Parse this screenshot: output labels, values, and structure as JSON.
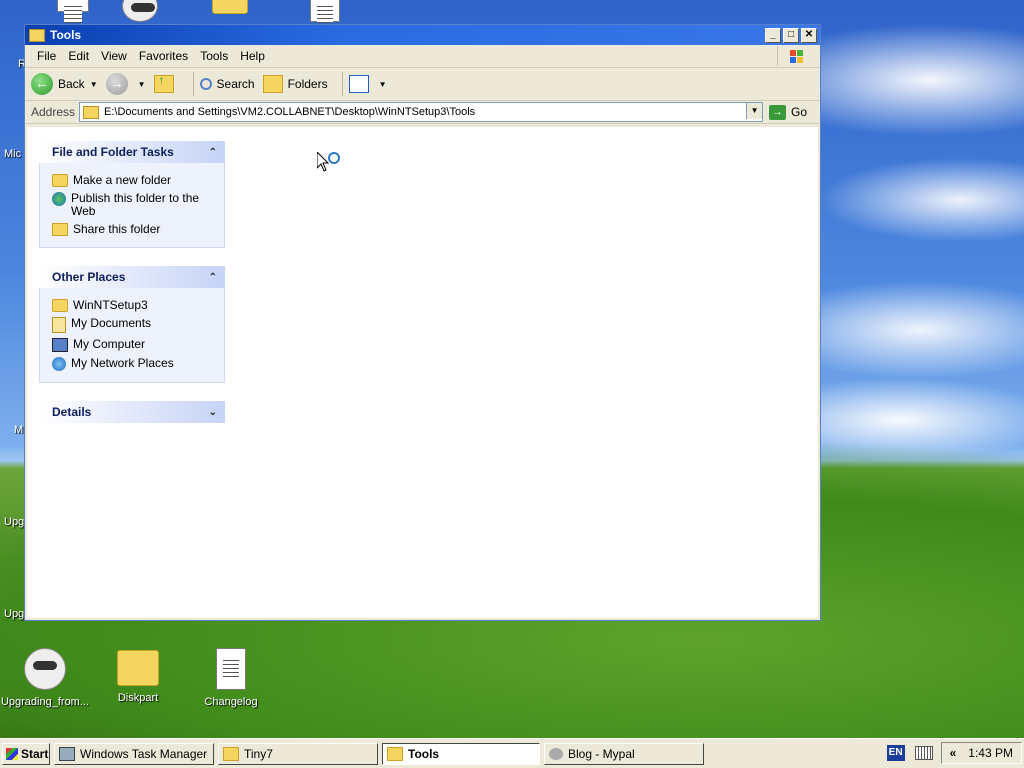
{
  "window": {
    "title": "Tools",
    "min": "_",
    "max": "□",
    "close": "✕"
  },
  "menu": [
    "File",
    "Edit",
    "View",
    "Favorites",
    "Tools",
    "Help"
  ],
  "toolbar": {
    "back": "Back",
    "search": "Search",
    "folders": "Folders"
  },
  "address": {
    "label": "Address",
    "path": "E:\\Documents and Settings\\VM2.COLLABNET\\Desktop\\WinNTSetup3\\Tools",
    "go": "Go"
  },
  "tasks_panel": {
    "title": "File and Folder Tasks",
    "items": [
      "Make a new folder",
      "Publish this folder to the Web",
      "Share this folder"
    ]
  },
  "places_panel": {
    "title": "Other Places",
    "items": [
      "WinNTSetup3",
      "My Documents",
      "My Computer",
      "My Network Places"
    ]
  },
  "details_panel": {
    "title": "Details"
  },
  "desktop": {
    "icons": [
      "Upgrading_from...",
      "Diskpart",
      "Changelog"
    ],
    "edge_labels": [
      "Mic",
      "M",
      "Upg",
      "Upg",
      "R"
    ]
  },
  "taskbar": {
    "start": "Start",
    "tasks": [
      "Windows Task Manager",
      "Tiny7",
      "Tools",
      "Blog - Mypal"
    ],
    "lang": "EN",
    "chevron": "«",
    "clock": "1:43 PM"
  }
}
